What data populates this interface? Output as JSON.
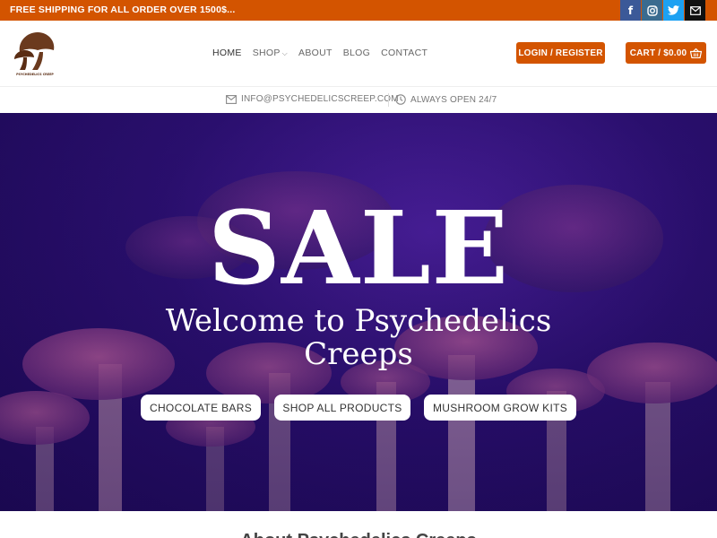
{
  "topbar": {
    "promo": "FREE SHIPPING FOR ALL ORDER OVER 1500$...",
    "social": [
      {
        "name": "facebook-icon",
        "glyph": "f"
      },
      {
        "name": "instagram-icon",
        "glyph": "◎"
      },
      {
        "name": "twitter-icon",
        "glyph": "🐦"
      },
      {
        "name": "email-icon",
        "glyph": "✉"
      }
    ]
  },
  "header": {
    "logo_text": "PSYCHEDELICS CREEP",
    "nav": {
      "home": "HOME",
      "shop": "SHOP",
      "about": "ABOUT",
      "blog": "BLOG",
      "contact": "CONTACT"
    },
    "login_label": "LOGIN / REGISTER",
    "cart_label": "CART / $0.00"
  },
  "infobar": {
    "email": "INFO@PSYCHEDELICSCREEP.COM",
    "hours": "ALWAYS OPEN 24/7"
  },
  "hero": {
    "sale": "SALE",
    "welcome": "Welcome to Psychedelics Creeps",
    "buttons": {
      "chocolate": "CHOCOLATE BARS",
      "shop_all": "SHOP ALL PRODUCTS",
      "grow_kits": "MUSHROOM GROW KITS"
    }
  },
  "about": {
    "heading": "About Psychedelics Creeps"
  },
  "colors": {
    "accent": "#d35400",
    "hero_bg": "#2a0f6e"
  }
}
